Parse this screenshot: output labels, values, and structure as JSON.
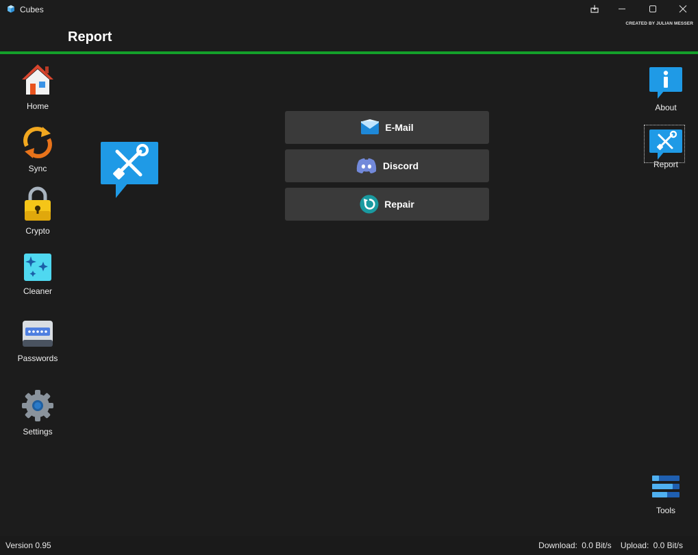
{
  "window": {
    "title": "Cubes",
    "credit": "CREATED BY JULIAN MESSER"
  },
  "header": {
    "title": "Report"
  },
  "colors": {
    "accent": "#14a02a",
    "background": "#1c1c1c",
    "button": "#3a3a3a"
  },
  "left_nav": [
    {
      "label": "Home",
      "icon": "home-icon"
    },
    {
      "label": "Sync",
      "icon": "sync-icon"
    },
    {
      "label": "Crypto",
      "icon": "lock-icon"
    },
    {
      "label": "Cleaner",
      "icon": "sparkle-icon"
    },
    {
      "label": "Passwords",
      "icon": "password-icon"
    },
    {
      "label": "Settings",
      "icon": "gear-icon"
    }
  ],
  "right_nav": [
    {
      "label": "About",
      "icon": "info-icon"
    },
    {
      "label": "Report",
      "icon": "report-icon",
      "selected": true
    },
    {
      "label": "Tools",
      "icon": "tools-icon"
    }
  ],
  "actions": [
    {
      "label": "E-Mail",
      "icon": "mail-icon"
    },
    {
      "label": "Discord",
      "icon": "discord-icon"
    },
    {
      "label": "Repair",
      "icon": "repair-icon"
    }
  ],
  "status": {
    "version": "Version 0.95",
    "download_label": "Download:",
    "download_value": "0.0 Bit/s",
    "upload_label": "Upload:",
    "upload_value": "0.0 Bit/s"
  }
}
